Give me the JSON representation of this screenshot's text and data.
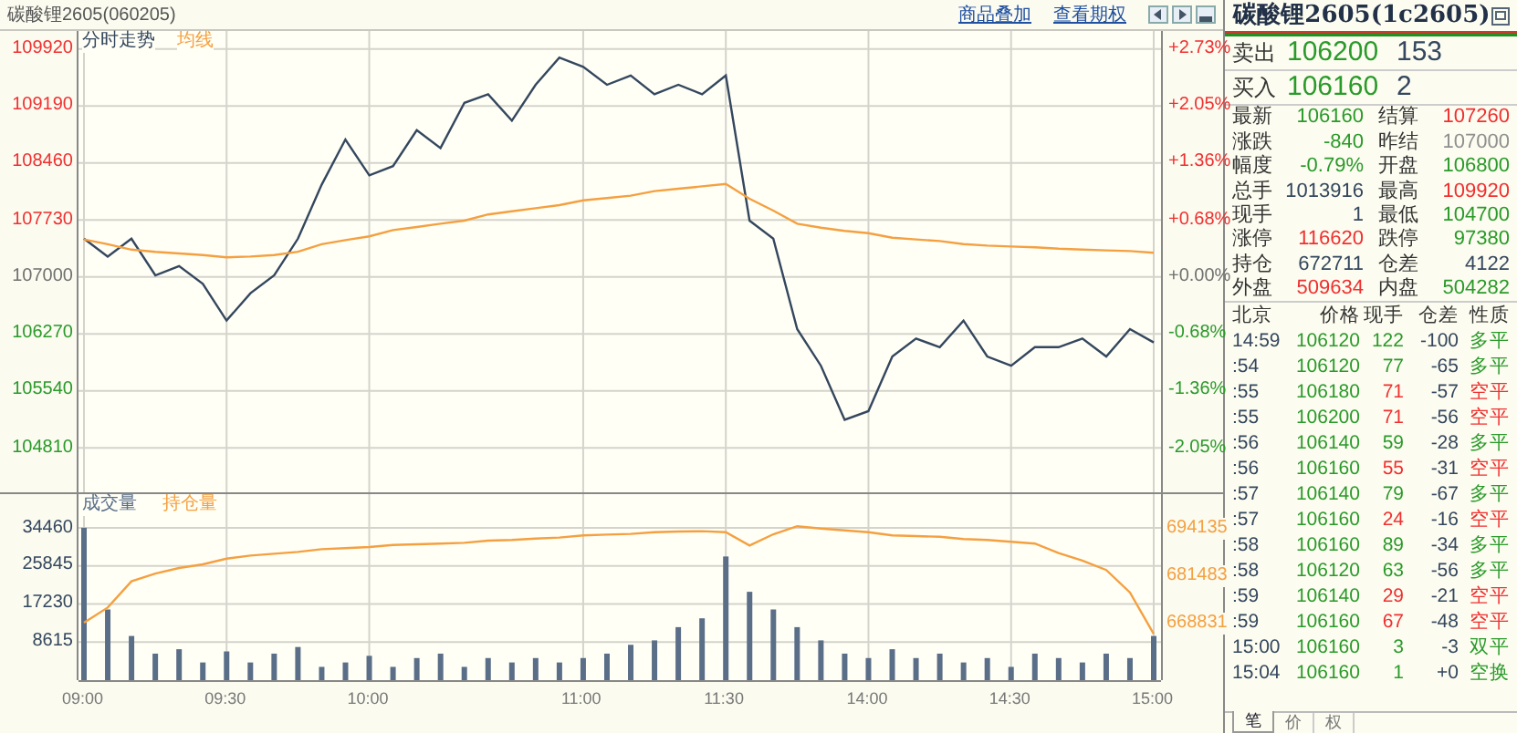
{
  "header": {
    "title": "碳酸锂2605(060205)",
    "links": [
      "商品叠加",
      "查看期权"
    ]
  },
  "price_chart": {
    "percent_axis": [
      {
        "label": "+2.73%",
        "color": "#f03030"
      },
      {
        "label": "+2.05%",
        "color": "#f03030"
      },
      {
        "label": "+1.36%",
        "color": "#f03030"
      },
      {
        "label": "+0.68%",
        "color": "#f03030"
      },
      {
        "label": "+0.00%",
        "color": "#707070"
      },
      {
        "label": "-0.68%",
        "color": "#2a9a2a"
      },
      {
        "label": "-1.36%",
        "color": "#2a9a2a"
      },
      {
        "label": "-2.05%",
        "color": "#2a9a2a"
      }
    ],
    "chart_data": {
      "type": "line",
      "grid": true,
      "series": [
        {
          "name": "分时走势",
          "color": "#34475e",
          "values": [
            107490,
            107260,
            107490,
            107020,
            107140,
            106910,
            106440,
            106790,
            107020,
            107490,
            108180,
            108760,
            108300,
            108420,
            108880,
            108650,
            109230,
            109340,
            109000,
            109460,
            109810,
            109690,
            109460,
            109580,
            109340,
            109460,
            109340,
            109580,
            107720,
            107490,
            106330,
            105860,
            105170,
            105280,
            105980,
            106210,
            106100,
            106440,
            105980,
            105860,
            106100,
            106100,
            106210,
            105980,
            106330,
            106160
          ]
        },
        {
          "name": "均线",
          "color": "#f5a040",
          "values": [
            107480,
            107420,
            107350,
            107320,
            107300,
            107280,
            107250,
            107260,
            107280,
            107320,
            107420,
            107470,
            107520,
            107600,
            107640,
            107680,
            107720,
            107800,
            107840,
            107880,
            107920,
            107980,
            108010,
            108040,
            108100,
            108130,
            108160,
            108190,
            108000,
            107850,
            107680,
            107630,
            107590,
            107560,
            107500,
            107480,
            107460,
            107420,
            107400,
            107390,
            107380,
            107360,
            107350,
            107340,
            107330,
            107310
          ]
        }
      ],
      "ylim": [
        104240,
        110150
      ],
      "yticks": [
        {
          "value": 109920,
          "label": "109920"
        },
        {
          "value": 109190,
          "label": "109190"
        },
        {
          "value": 108460,
          "label": "108460"
        },
        {
          "value": 107730,
          "label": "107730"
        },
        {
          "value": 107000,
          "label": "107000"
        },
        {
          "value": 106270,
          "label": "106270"
        },
        {
          "value": 105540,
          "label": "105540"
        },
        {
          "value": 104810,
          "label": "104810"
        }
      ]
    }
  },
  "volume_chart": {
    "chart_data": {
      "type": "bar",
      "grid": true,
      "series": [
        {
          "name": "成交量",
          "color": "#5a6e88",
          "values": [
            34500,
            16000,
            10000,
            6000,
            7000,
            4000,
            6500,
            4000,
            6000,
            7500,
            3000,
            4000,
            5500,
            3000,
            5000,
            6000,
            3000,
            5000,
            4000,
            5000,
            4000,
            5000,
            6000,
            8000,
            9000,
            12000,
            14000,
            28000,
            20000,
            16000,
            12000,
            9000,
            6000,
            5000,
            7000,
            5000,
            6000,
            4000,
            5000,
            3000,
            6000,
            5000,
            4000,
            6000,
            5000,
            10000
          ]
        }
      ],
      "ylim": [
        0,
        42115
      ],
      "yticks": [
        {
          "value": 34460,
          "label": "34460"
        },
        {
          "value": 25845,
          "label": "25845"
        },
        {
          "value": 17230,
          "label": "17230"
        },
        {
          "value": 8615,
          "label": "8615"
        }
      ]
    },
    "time_axis": [
      "09:00",
      "09:30",
      "10:00",
      "11:00",
      "11:30",
      "14:00",
      "14:30",
      "15:00"
    ]
  },
  "open_interest_chart": {
    "chart_data": {
      "type": "line",
      "series": [
        {
          "name": "持仓量",
          "color": "#f5a040",
          "values": [
            669000,
            673000,
            680000,
            682000,
            683500,
            684500,
            686000,
            686800,
            687300,
            687800,
            688500,
            688800,
            689100,
            689600,
            689800,
            690000,
            690200,
            690800,
            691000,
            691300,
            691600,
            692200,
            692400,
            692600,
            693000,
            693200,
            693300,
            693000,
            689500,
            692500,
            694600,
            694000,
            693500,
            693000,
            692200,
            692000,
            691800,
            691200,
            691000,
            690500,
            690000,
            687500,
            685500,
            683000,
            677000,
            666000
          ]
        }
      ],
      "ylim": [
        653750,
        703130
      ],
      "yticks": [
        {
          "value": 694135,
          "label": "694135"
        },
        {
          "value": 681483,
          "label": "681483"
        },
        {
          "value": 668831,
          "label": "668831"
        }
      ]
    }
  },
  "quote": {
    "title": "碳酸锂2605(1c2605)",
    "ask": {
      "label": "卖出",
      "price": "106200",
      "volume": "153"
    },
    "bid": {
      "label": "买入",
      "price": "106160",
      "volume": "2"
    },
    "stats": [
      {
        "label": "最新",
        "value": "106160",
        "color": "#2a9a2a"
      },
      {
        "label": "结算",
        "value": "107260",
        "color": "#f03030"
      },
      {
        "label": "涨跌",
        "value": "-840",
        "color": "#2a9a2a"
      },
      {
        "label": "昨结",
        "value": "107000",
        "color": "#909090"
      },
      {
        "label": "幅度",
        "value": "-0.79%",
        "color": "#2a9a2a"
      },
      {
        "label": "开盘",
        "value": "106800",
        "color": "#2a9a2a"
      },
      {
        "label": "总手",
        "value": "1013916",
        "color": "#34475e"
      },
      {
        "label": "最高",
        "value": "109920",
        "color": "#f03030"
      },
      {
        "label": "现手",
        "value": "1",
        "color": "#34475e"
      },
      {
        "label": "最低",
        "value": "104700",
        "color": "#2a9a2a"
      },
      {
        "label": "涨停",
        "value": "116620",
        "color": "#f03030"
      },
      {
        "label": "跌停",
        "value": "97380",
        "color": "#2a9a2a"
      },
      {
        "label": "持仓",
        "value": "672711",
        "color": "#34475e"
      },
      {
        "label": "仓差",
        "value": "4122",
        "color": "#34475e"
      },
      {
        "label": "外盘",
        "value": "509634",
        "color": "#f03030"
      },
      {
        "label": "内盘",
        "value": "504282",
        "color": "#2a9a2a"
      }
    ],
    "trade_columns": [
      "北京",
      "价格",
      "现手",
      "仓差",
      "性质"
    ],
    "trades": [
      {
        "time": "14:59",
        "price": "106120",
        "volume": "122",
        "change": "-100",
        "nature": "多平",
        "color": "#2a9a2a"
      },
      {
        "time": ":54",
        "price": "106120",
        "volume": "77",
        "change": "-65",
        "nature": "多平",
        "color": "#2a9a2a"
      },
      {
        "time": ":55",
        "price": "106180",
        "volume": "71",
        "change": "-57",
        "nature": "空平",
        "color": "#f03030"
      },
      {
        "time": ":55",
        "price": "106200",
        "volume": "71",
        "change": "-56",
        "nature": "空平",
        "color": "#f03030"
      },
      {
        "time": ":56",
        "price": "106140",
        "volume": "59",
        "change": "-28",
        "nature": "多平",
        "color": "#2a9a2a"
      },
      {
        "time": ":56",
        "price": "106160",
        "volume": "55",
        "change": "-31",
        "nature": "空平",
        "color": "#f03030"
      },
      {
        "time": ":57",
        "price": "106140",
        "volume": "79",
        "change": "-67",
        "nature": "多平",
        "color": "#2a9a2a"
      },
      {
        "time": ":57",
        "price": "106160",
        "volume": "24",
        "change": "-16",
        "nature": "空平",
        "color": "#f03030"
      },
      {
        "time": ":58",
        "price": "106160",
        "volume": "89",
        "change": "-34",
        "nature": "多平",
        "color": "#2a9a2a"
      },
      {
        "time": ":58",
        "price": "106120",
        "volume": "63",
        "change": "-56",
        "nature": "多平",
        "color": "#2a9a2a"
      },
      {
        "time": ":59",
        "price": "106140",
        "volume": "29",
        "change": "-21",
        "nature": "空平",
        "color": "#f03030"
      },
      {
        "time": ":59",
        "price": "106160",
        "volume": "67",
        "change": "-48",
        "nature": "空平",
        "color": "#f03030"
      },
      {
        "time": "15:00",
        "price": "106160",
        "volume": "3",
        "change": "-3",
        "nature": "双平",
        "color": "#2a9a2a"
      },
      {
        "time": "15:04",
        "price": "106160",
        "volume": "1",
        "change": "+0",
        "nature": "空换",
        "color": "#2a9a2a"
      }
    ],
    "tabs": [
      {
        "label": "笔",
        "selected": true
      },
      {
        "label": "价",
        "selected": false
      },
      {
        "label": "权",
        "selected": false
      }
    ]
  }
}
